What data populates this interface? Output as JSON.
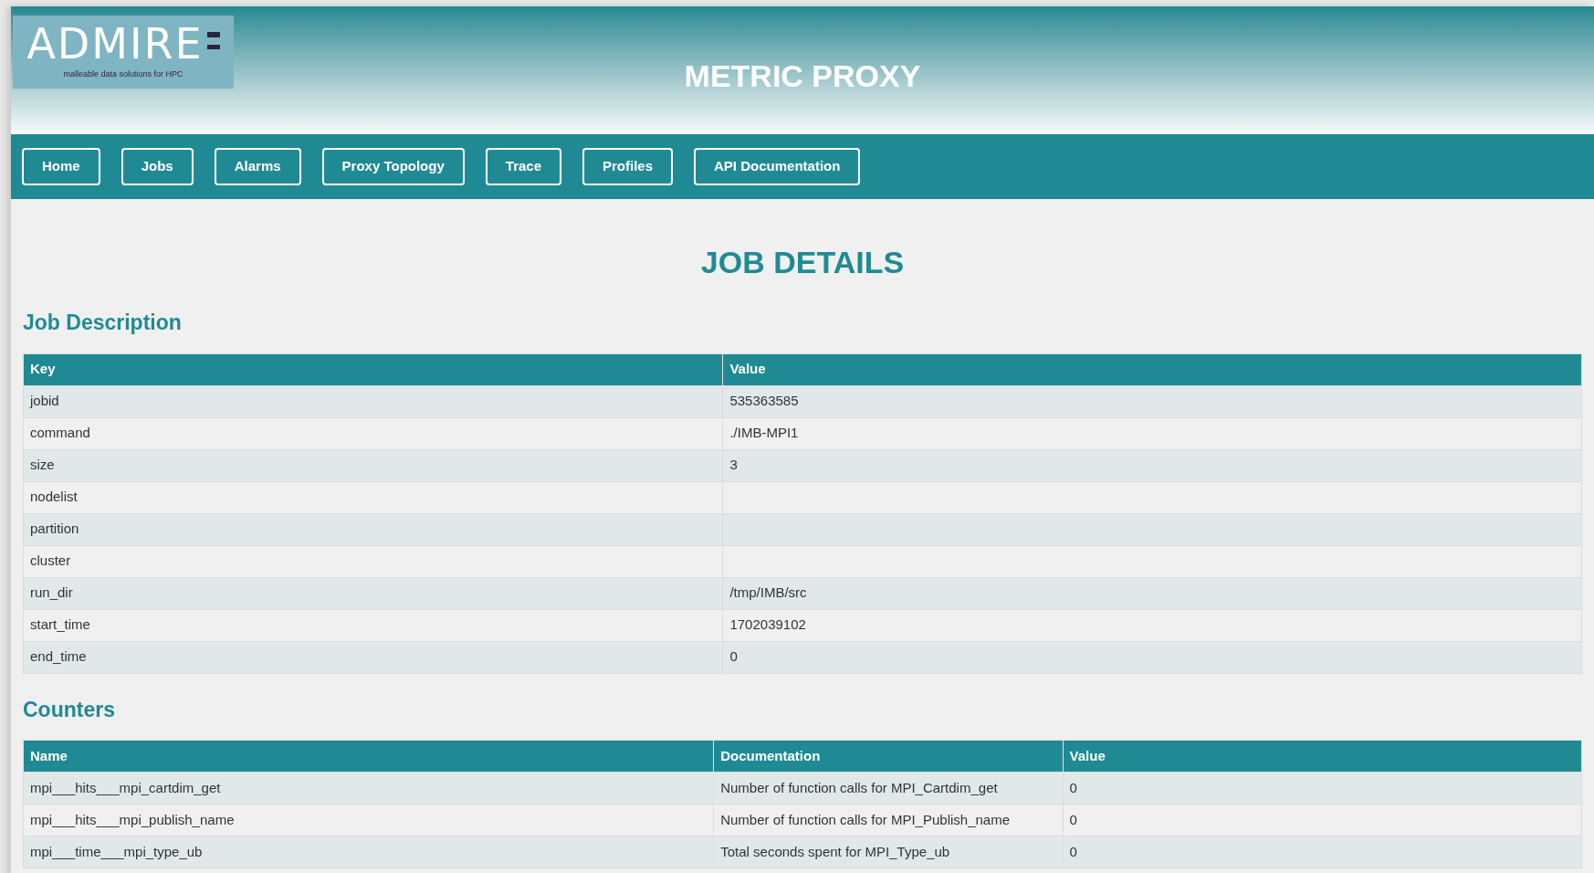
{
  "logo": {
    "wordmark": "ADMIRE",
    "tagline": "malleable data solutions for HPC"
  },
  "header": {
    "title": "METRIC PROXY"
  },
  "nav": [
    "Home",
    "Jobs",
    "Alarms",
    "Proxy Topology",
    "Trace",
    "Profiles",
    "API Documentation"
  ],
  "page_title": "JOB DETAILS",
  "job_description": {
    "heading": "Job Description",
    "columns": [
      "Key",
      "Value"
    ],
    "rows": [
      [
        "jobid",
        "535363585"
      ],
      [
        "command",
        "./IMB-MPI1"
      ],
      [
        "size",
        "3"
      ],
      [
        "nodelist",
        ""
      ],
      [
        "partition",
        ""
      ],
      [
        "cluster",
        ""
      ],
      [
        "run_dir",
        "/tmp/IMB/src"
      ],
      [
        "start_time",
        "1702039102"
      ],
      [
        "end_time",
        "0"
      ]
    ]
  },
  "counters": {
    "heading": "Counters",
    "columns": [
      "Name",
      "Documentation",
      "Value"
    ],
    "rows": [
      [
        "mpi___hits___mpi_cartdim_get",
        "Number of function calls for MPI_Cartdim_get",
        "0"
      ],
      [
        "mpi___hits___mpi_publish_name",
        "Number of function calls for MPI_Publish_name",
        "0"
      ],
      [
        "mpi___time___mpi_type_ub",
        "Total seconds spent for MPI_Type_ub",
        "0"
      ]
    ]
  }
}
